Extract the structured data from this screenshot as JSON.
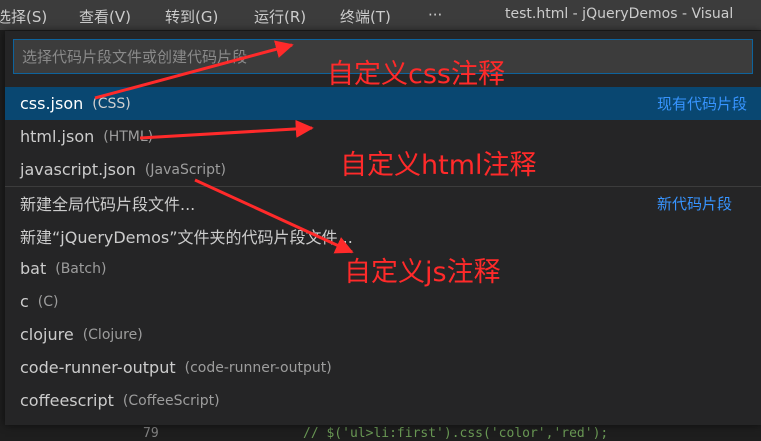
{
  "menu": {
    "items": [
      "选择(S)",
      "查看(V)",
      "转到(G)",
      "运行(R)",
      "终端(T)",
      "···"
    ],
    "window_title": "test.html - jQueryDemos - Visual"
  },
  "quick_pick": {
    "placeholder": "选择代码片段文件或创建代码片段",
    "groups": {
      "existing": "现有代码片段",
      "new": "新代码片段"
    },
    "items": [
      {
        "label": "css.json",
        "description": "(CSS)"
      },
      {
        "label": "html.json",
        "description": "(HTML)"
      },
      {
        "label": "javascript.json",
        "description": "(JavaScript)"
      },
      {
        "label": "新建全局代码片段文件..."
      },
      {
        "label": "新建“jQueryDemos”文件夹的代码片段文件..."
      },
      {
        "label": "bat",
        "description": "(Batch)"
      },
      {
        "label": "c",
        "description": "(C)"
      },
      {
        "label": "clojure",
        "description": "(Clojure)"
      },
      {
        "label": "code-runner-output",
        "description": "(code-runner-output)"
      },
      {
        "label": "coffeescript",
        "description": "(CoffeeScript)"
      }
    ]
  },
  "background": {
    "line_number": "79",
    "code": "// $('ul>li:first').css('color','red');"
  },
  "annotations": {
    "css": "自定义css注释",
    "html": "自定义html注释",
    "js": "自定义js注释"
  },
  "colors": {
    "annotation": "#ff2a2a",
    "selection": "#094771",
    "link": "#3794ff"
  }
}
